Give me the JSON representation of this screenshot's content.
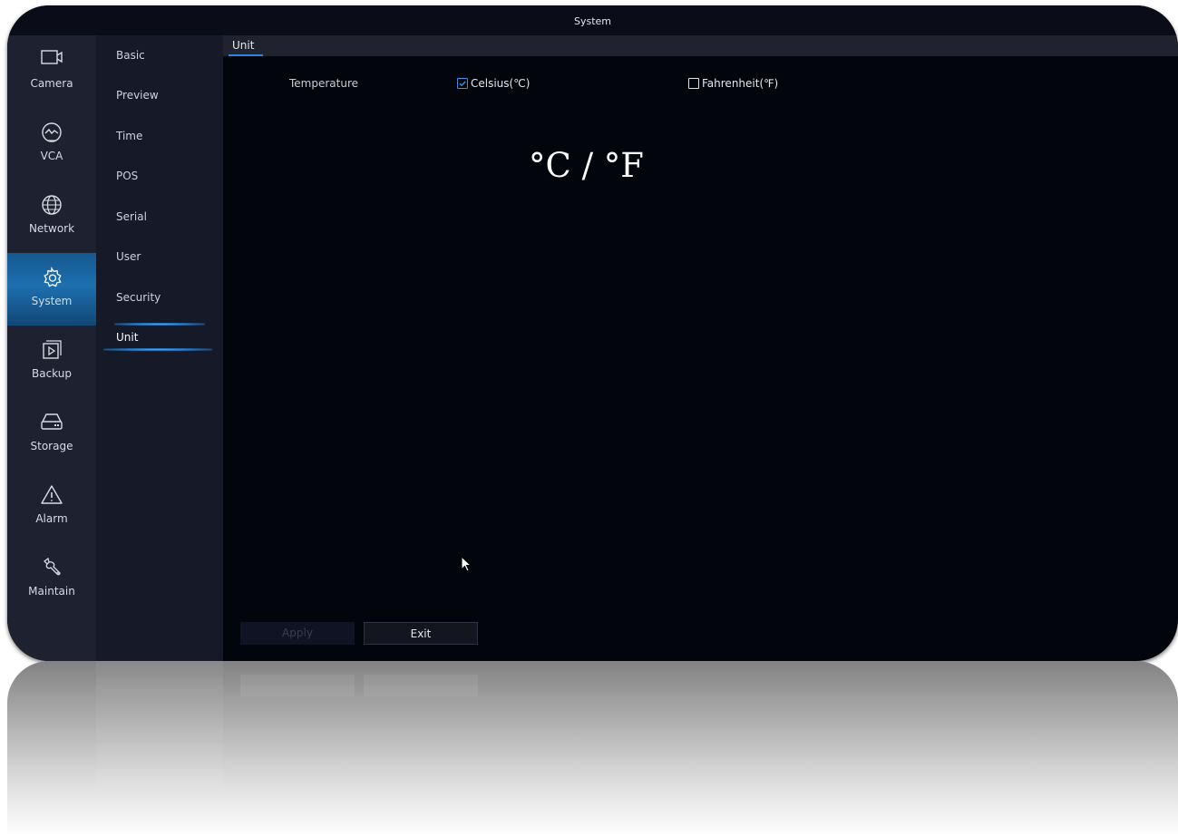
{
  "window": {
    "title": "System"
  },
  "nav": {
    "items": [
      {
        "label": "Camera",
        "icon": "camera-icon"
      },
      {
        "label": "VCA",
        "icon": "vca-icon"
      },
      {
        "label": "Network",
        "icon": "globe-icon"
      },
      {
        "label": "System",
        "icon": "gear-icon",
        "active": true
      },
      {
        "label": "Backup",
        "icon": "backup-icon"
      },
      {
        "label": "Storage",
        "icon": "storage-icon"
      },
      {
        "label": "Alarm",
        "icon": "alarm-icon"
      },
      {
        "label": "Maintain",
        "icon": "wrench-icon"
      }
    ]
  },
  "submenu": {
    "items": [
      "Basic",
      "Preview",
      "Time",
      "POS",
      "Serial",
      "User",
      "Security",
      "Unit"
    ],
    "selected": "Unit"
  },
  "tab": {
    "label": "Unit"
  },
  "settings": {
    "temperature_label": "Temperature",
    "celsius": {
      "label": "Celsius(℃)",
      "checked": true
    },
    "fahrenheit": {
      "label": "Fahrenheit(℉)",
      "checked": false
    }
  },
  "overlay_text": "°C / °F",
  "buttons": {
    "apply": "Apply",
    "exit": "Exit"
  },
  "colors": {
    "accent": "#2d86db",
    "active_nav": "#1d6fae",
    "background": "#03050d"
  }
}
